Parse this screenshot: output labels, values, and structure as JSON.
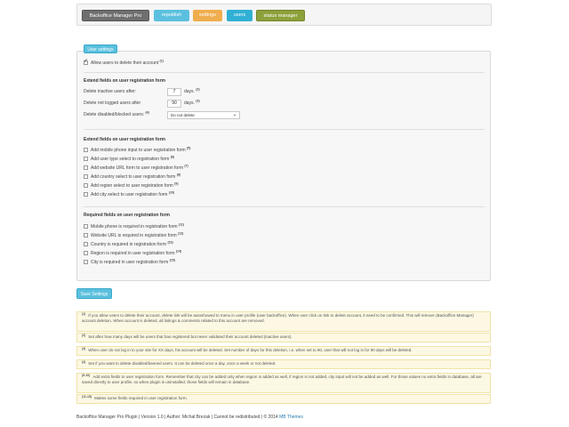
{
  "nav": {
    "items": [
      {
        "label": "Backoffice Manager Pro"
      },
      {
        "label": "republish"
      },
      {
        "label": "settings"
      },
      {
        "label": "users"
      },
      {
        "label": "status manager"
      }
    ]
  },
  "panel": {
    "tab_label": "User settings",
    "allow_delete": {
      "label": "Allow users to delete their account",
      "ref": "(1)",
      "checked": true
    },
    "extend_section": {
      "title": "Extend fields on user registration form",
      "inactive": {
        "label": "Delete inactive users after:",
        "value": "7",
        "unit": "days.",
        "ref": "(2)"
      },
      "not_logged": {
        "label": "Delete not logged users after",
        "value": "90",
        "unit": "days.",
        "ref": "(3)"
      },
      "disabled": {
        "label": "Delete disabled/blocked users:",
        "ref": "(4)",
        "selected": "Do not delete"
      }
    },
    "extend_section2": {
      "title": "Extend fields on user registration form",
      "items": [
        {
          "label": "Add mobile phone input to user registration form",
          "ref": "(5)"
        },
        {
          "label": "Add user type select to registration form",
          "ref": "(6)"
        },
        {
          "label": "Add website URL form to user registration form",
          "ref": "(7)"
        },
        {
          "label": "Add country select to user registration form",
          "ref": "(8)"
        },
        {
          "label": "Add region select to user registration form",
          "ref": "(9)"
        },
        {
          "label": "Add city select to user registration form",
          "ref": "(10)"
        }
      ]
    },
    "required_section": {
      "title": "Required fields on user registration form",
      "items": [
        {
          "label": "Mobile phone is required in registration form",
          "ref": "(11)"
        },
        {
          "label": "Website URL is required in registration form",
          "ref": "(12)"
        },
        {
          "label": "Country is required in registration form",
          "ref": "(13)"
        },
        {
          "label": "Region is required in user registration form",
          "ref": "(14)"
        },
        {
          "label": "City is required in user registration form",
          "ref": "(15)"
        }
      ]
    }
  },
  "save_label": "Save Settings",
  "notes": [
    {
      "ref": "(1)",
      "text": "If you allow users to delete their account, delete link will be autoshowed to menu in user profile (user backoffice). When user click on link to delete account, it need to be confirmed. This will remove (Backoffice Manager) account deletion. When account is deleted, all listings & comments related to this account are removed."
    },
    {
      "ref": "(2)",
      "text": "Set after how many days will be users that has registered but never validated their account deleted (inactive users)."
    },
    {
      "ref": "(3)",
      "text": "When user do not log in to your site for XX days, his account will be deleted. Set number of days for this deletion, i.e. when set to 90, user that will not log in for 90 days will be deleted."
    },
    {
      "ref": "(4)",
      "text": "Set if you want to delete disabled/banned users. It can be deleted once a day, once a week or not deleted."
    },
    {
      "ref": "(5-10)",
      "text": "Add extra fields to user registration form. Remember that city can be added only when region is added as well, if region is not added, city input will not be added as well. For those values no extra fields in database, all are saved directly to user profile, so when plugin is uninstalled, those fields will remain in database."
    },
    {
      "ref": "(11-15)",
      "text": "Makes some fields required in user registration form."
    }
  ],
  "footer": {
    "text": "Backoffice Manager Pro Plugin | Version 1.0 | Author: Michal Brezak | Cannot be redistributed | © 2014",
    "link": "MB Themes"
  }
}
